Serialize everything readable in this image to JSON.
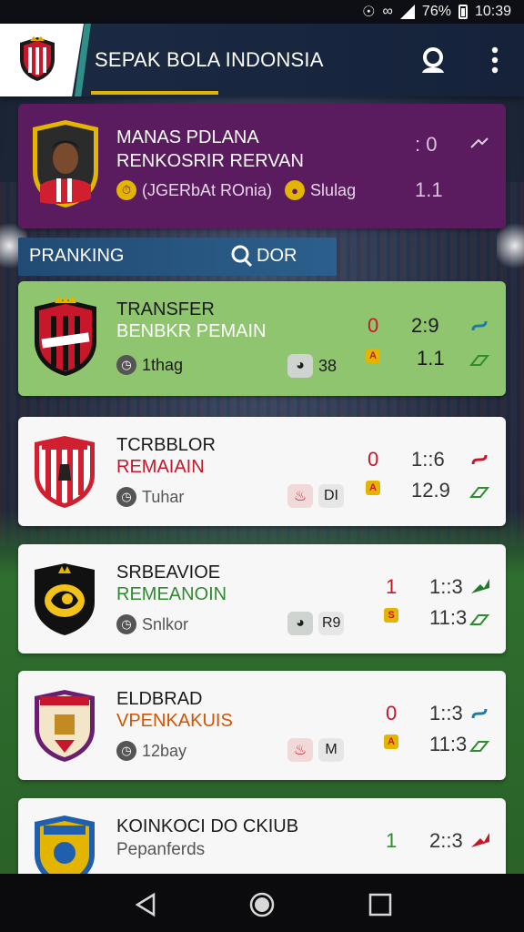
{
  "status_bar": {
    "battery": "76%",
    "time": "10:39"
  },
  "app_bar": {
    "title": "SEPAK BOLA INDONSIA"
  },
  "featured": {
    "line1": "MANAS PDLANA",
    "line2": "RENKOSRIR RERVAN",
    "meta_left": "(JGERbAt ROnia)",
    "meta_right": "Slulag",
    "num_top": ": 0",
    "num_bottom": "1.1"
  },
  "ranking": {
    "label": "PRANKING",
    "search_label": "DOR"
  },
  "cards": [
    {
      "line1": "TRANSFER",
      "line2": "BENBKR PEMAIN",
      "meta_left": "1thag",
      "pill_right": "38",
      "score_a": "0",
      "score_b": "2:9",
      "num_b": "1.1",
      "crest_color": "#c8162a",
      "accent": "#e3a400"
    },
    {
      "line1": "TCRBBLOR",
      "line2": "REMAIAIN",
      "meta_left": "Tuhar",
      "pill_right": "DI",
      "score_a": "0",
      "score_b": "1::6",
      "num_b": "12.9",
      "crest_color": "#d01f2e",
      "accent": "#e3a400"
    },
    {
      "line1": "SRBEAVIOE",
      "line2": "REMEANOIN",
      "meta_left": "Snlkor",
      "pill_right": "R9",
      "score_a": "1",
      "score_b": "1::3",
      "num_b": "11:3",
      "crest_color": "#f2c21a",
      "accent": "#e3a400"
    },
    {
      "line1": "ELDBRAD",
      "line2": "VPENKAKUIS",
      "meta_left": "12bay",
      "pill_right": "M",
      "score_a": "0",
      "score_b": "1::3",
      "num_b": "11:3",
      "crest_color": "#6b1d6f",
      "accent": "#e3a400"
    },
    {
      "line1": "KOINKOCI DO CKIUB",
      "line2": "Pepanferds",
      "score_a": "1",
      "score_b": "2::3",
      "crest_color": "#1f5fae",
      "accent": "#e3a400"
    }
  ],
  "icons": {
    "profile": "profile-icon",
    "more": "more-vert-icon",
    "search": "search-icon",
    "back": "back-icon",
    "home": "home-icon",
    "recents": "recents-icon"
  }
}
